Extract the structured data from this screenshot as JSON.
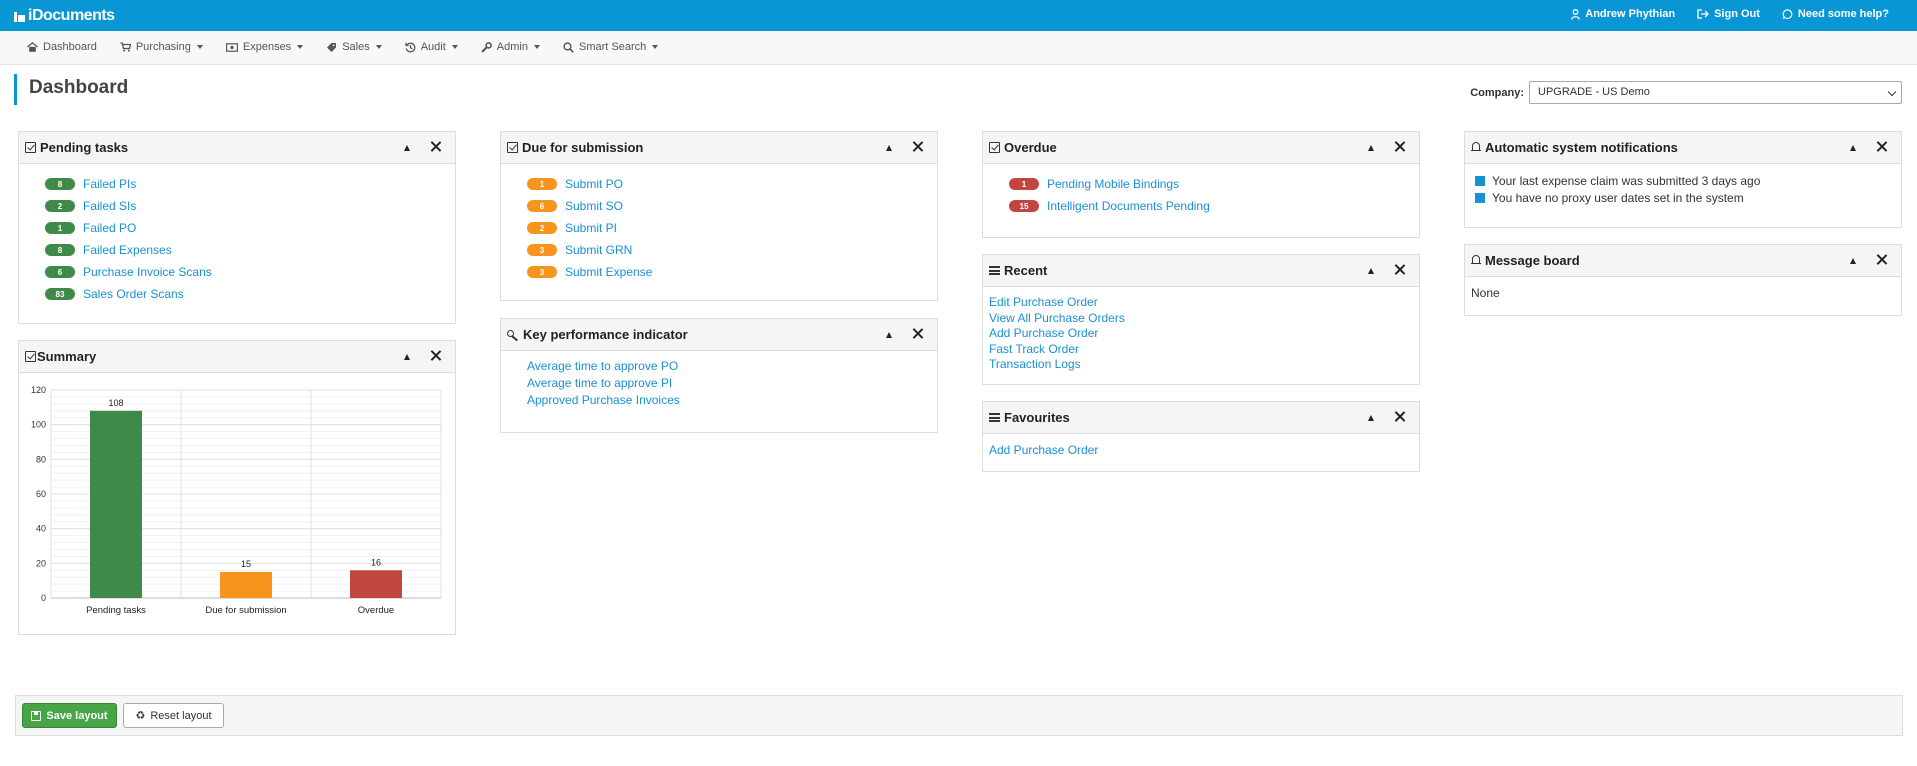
{
  "topbar": {
    "brand": "iDocuments",
    "user": "Andrew Phythian",
    "sign_out": "Sign Out",
    "help": "Need some help?"
  },
  "nav": {
    "items": [
      {
        "label": "Dashboard",
        "icon": "home-icon",
        "dropdown": false
      },
      {
        "label": "Purchasing",
        "icon": "cart-icon",
        "dropdown": true
      },
      {
        "label": "Expenses",
        "icon": "money-icon",
        "dropdown": true
      },
      {
        "label": "Sales",
        "icon": "tag-icon",
        "dropdown": true
      },
      {
        "label": "Audit",
        "icon": "history-icon",
        "dropdown": true
      },
      {
        "label": "Admin",
        "icon": "wrench-icon",
        "dropdown": true
      },
      {
        "label": "Smart Search",
        "icon": "search-icon",
        "dropdown": true
      }
    ]
  },
  "page": {
    "title": "Dashboard",
    "company_label": "Company:",
    "company_value": "UPGRADE - US Demo"
  },
  "panels": {
    "pending": {
      "title": "Pending tasks",
      "items": [
        {
          "count": "8",
          "label": "Failed PIs"
        },
        {
          "count": "2",
          "label": "Failed SIs"
        },
        {
          "count": "1",
          "label": "Failed PO"
        },
        {
          "count": "8",
          "label": "Failed Expenses"
        },
        {
          "count": "6",
          "label": "Purchase Invoice Scans"
        },
        {
          "count": "83",
          "label": "Sales Order Scans"
        }
      ]
    },
    "due": {
      "title": "Due for submission",
      "items": [
        {
          "count": "1",
          "label": "Submit PO"
        },
        {
          "count": "6",
          "label": "Submit SO"
        },
        {
          "count": "2",
          "label": "Submit PI"
        },
        {
          "count": "3",
          "label": "Submit GRN"
        },
        {
          "count": "3",
          "label": "Submit Expense"
        }
      ]
    },
    "overdue": {
      "title": "Overdue",
      "items": [
        {
          "count": "1",
          "label": "Pending Mobile Bindings"
        },
        {
          "count": "15",
          "label": "Intelligent Documents Pending"
        }
      ]
    },
    "notifications": {
      "title": "Automatic system notifications",
      "items": [
        "Your last expense claim was submitted 3 days ago",
        "You have no proxy user dates set in the system"
      ]
    },
    "summary": {
      "title": "Summary"
    },
    "kpi": {
      "title": "Key performance indicator",
      "items": [
        "Average time to approve PO",
        "Average time to approve PI",
        "Approved Purchase Invoices"
      ]
    },
    "recent": {
      "title": "Recent",
      "items": [
        "Edit Purchase Order",
        "View All Purchase Orders",
        "Add Purchase Order",
        "Fast Track Order",
        "Transaction Logs"
      ]
    },
    "favourites": {
      "title": "Favourites",
      "items": [
        "Add Purchase Order"
      ]
    },
    "message_board": {
      "title": "Message board",
      "content": "None"
    }
  },
  "chart_data": {
    "type": "bar",
    "categories": [
      "Pending tasks",
      "Due for submission",
      "Overdue"
    ],
    "values": [
      108,
      15,
      16
    ],
    "colors": [
      "#3f8a48",
      "#f7941d",
      "#c0463f"
    ],
    "ylim": [
      0,
      120
    ],
    "yticks": [
      0,
      20,
      40,
      60,
      80,
      100,
      120
    ],
    "grid": true
  },
  "footer": {
    "save": "Save layout",
    "reset": "Reset layout"
  },
  "colors": {
    "brand": "#0996d4",
    "link": "#1a90d6",
    "success": "#47a447"
  }
}
